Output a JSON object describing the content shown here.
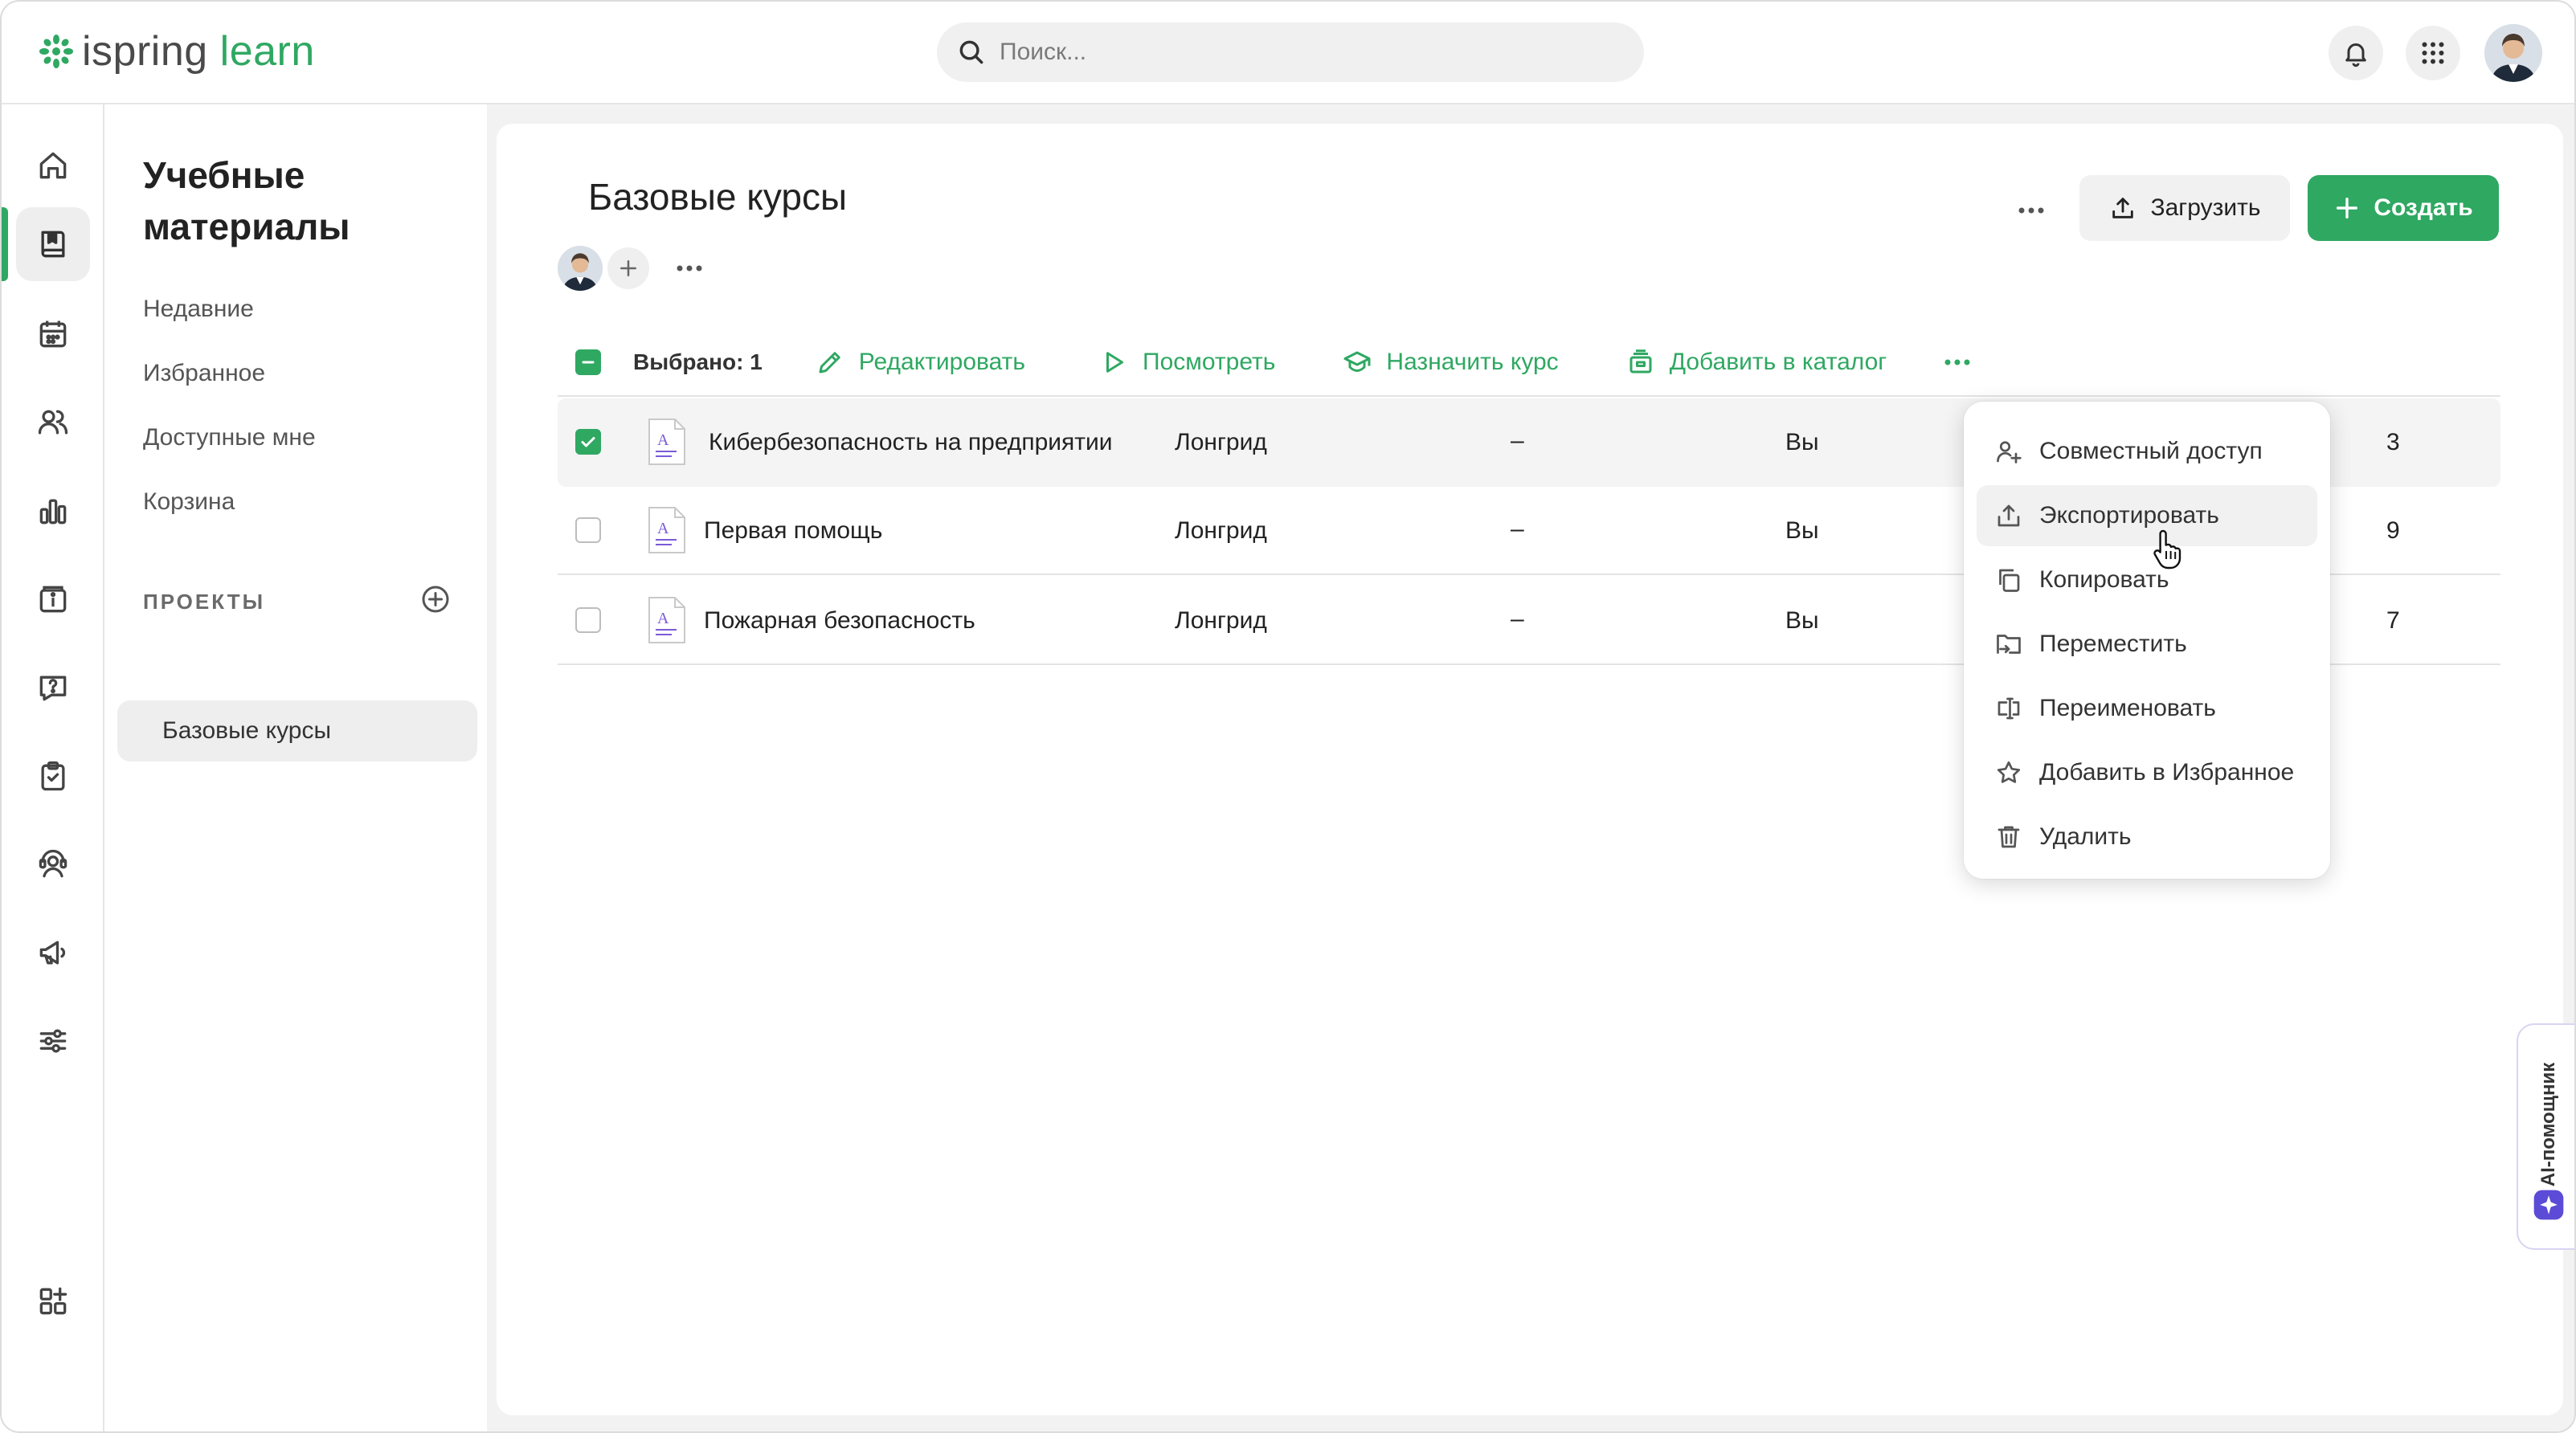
{
  "app": {
    "logo_prefix": "ispring",
    "logo_accent": "learn",
    "brand_color": "#2fa862"
  },
  "header": {
    "search_placeholder": "Поиск..."
  },
  "rail": {
    "items": [
      "home-icon",
      "book-icon",
      "calendar-icon",
      "users-icon",
      "chart-icon",
      "info-icon",
      "question-icon",
      "clipboard-check-icon",
      "support-icon",
      "megaphone-icon",
      "sliders-icon",
      "apps-add-icon"
    ],
    "active": "book-icon"
  },
  "sidebar": {
    "title": "Учебные материалы",
    "links": [
      "Недавние",
      "Избранное",
      "Доступные мне",
      "Корзина"
    ],
    "section_label": "ПРОЕКТЫ",
    "project": "Базовые курсы"
  },
  "main": {
    "title": "Базовые курсы",
    "upload_label": "Загрузить",
    "create_label": "Создать"
  },
  "toolbar": {
    "selected_count": "Выбрано: 1",
    "actions": [
      "Редактировать",
      "Посмотреть",
      "Назначить курс",
      "Добавить в каталог"
    ]
  },
  "rows": [
    {
      "name": "Кибербезопасность на предприятии",
      "type": "Лонгрид",
      "dash": "–",
      "owner": "Вы",
      "date_tail": "3",
      "checked": true
    },
    {
      "name": "Первая помощь",
      "type": "Лонгрид",
      "dash": "–",
      "owner": "Вы",
      "date_tail": "9",
      "checked": false
    },
    {
      "name": "Пожарная безопасность",
      "type": "Лонгрид",
      "dash": "–",
      "owner": "Вы",
      "date_tail": "7",
      "checked": false
    }
  ],
  "menu": {
    "items": [
      "Совместный доступ",
      "Экспортировать",
      "Копировать",
      "Переместить",
      "Переименовать",
      "Добавить в Избранное",
      "Удалить"
    ],
    "hovered": "Экспортировать"
  },
  "ai_helper": {
    "label": "AI-помощник",
    "color": "#5b4bd6"
  }
}
